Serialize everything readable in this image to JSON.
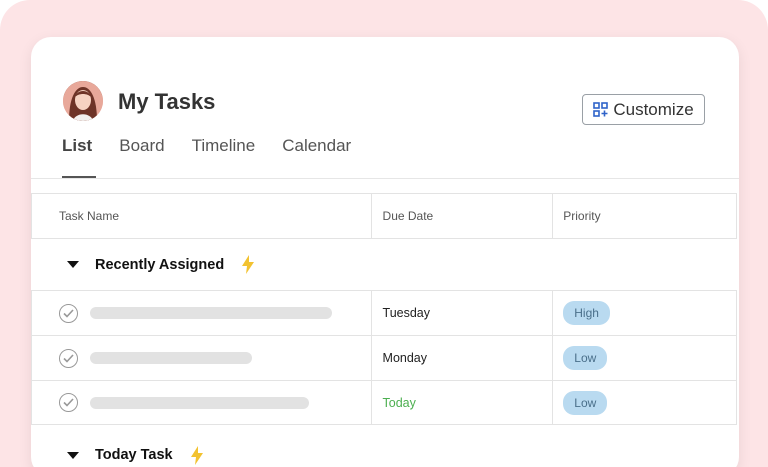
{
  "header": {
    "title": "My Tasks",
    "customize_label": "Customize"
  },
  "tabs": [
    {
      "label": "List",
      "active": true
    },
    {
      "label": "Board",
      "active": false
    },
    {
      "label": "Timeline",
      "active": false
    },
    {
      "label": "Calendar",
      "active": false
    }
  ],
  "table": {
    "columns": [
      "Task Name",
      "Due Date",
      "Priority"
    ],
    "groups": [
      {
        "name": "Recently Assigned",
        "rows": [
          {
            "due": "Tuesday",
            "priority": "High"
          },
          {
            "due": "Monday",
            "priority": "Low"
          },
          {
            "due": "Today",
            "priority": "Low"
          }
        ]
      },
      {
        "name": "Today Task",
        "rows": []
      }
    ]
  },
  "colors": {
    "frame_bg": "#fde4e6",
    "priority_badge": "#b9daf0",
    "today_text": "#4caf50",
    "bolt": "#f2c230"
  }
}
